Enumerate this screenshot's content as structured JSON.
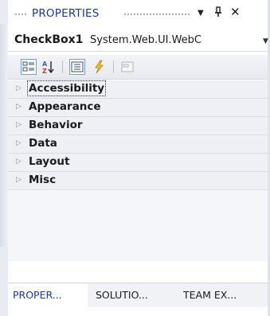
{
  "window": {
    "title": "PROPERTIES",
    "dropdown_icon": "triangle-down-icon",
    "pin_icon": "pin-icon",
    "close_icon": "close-icon",
    "dropdown_glyph": "▼",
    "pin_glyph": "ᚚ",
    "close_glyph": "✕"
  },
  "object_selector": {
    "name": "CheckBox1",
    "type": "System.Web.UI.WebC",
    "dropdown_glyph": "▼"
  },
  "toolbar": {
    "buttons": [
      {
        "name": "categorized",
        "active": true
      },
      {
        "name": "alphabetical",
        "active": false
      },
      {
        "name": "properties",
        "active": true
      },
      {
        "name": "events",
        "active": false
      },
      {
        "name": "property-pages",
        "active": false,
        "disabled": true
      }
    ]
  },
  "categories": [
    {
      "label": "Accessibility",
      "expander": "▷"
    },
    {
      "label": "Appearance",
      "expander": "▷"
    },
    {
      "label": "Behavior",
      "expander": "▷"
    },
    {
      "label": "Data",
      "expander": "▷"
    },
    {
      "label": "Layout",
      "expander": "▷"
    },
    {
      "label": "Misc",
      "expander": "▷"
    }
  ],
  "bottom_tabs": [
    {
      "label": "PROPER..."
    },
    {
      "label": "SOLUTIO..."
    },
    {
      "label": "TEAM EX..."
    }
  ],
  "colors": {
    "title": "#1e3a8a",
    "category_bg": "#eef0f5",
    "active_tab_text": "#1e3a8a"
  }
}
